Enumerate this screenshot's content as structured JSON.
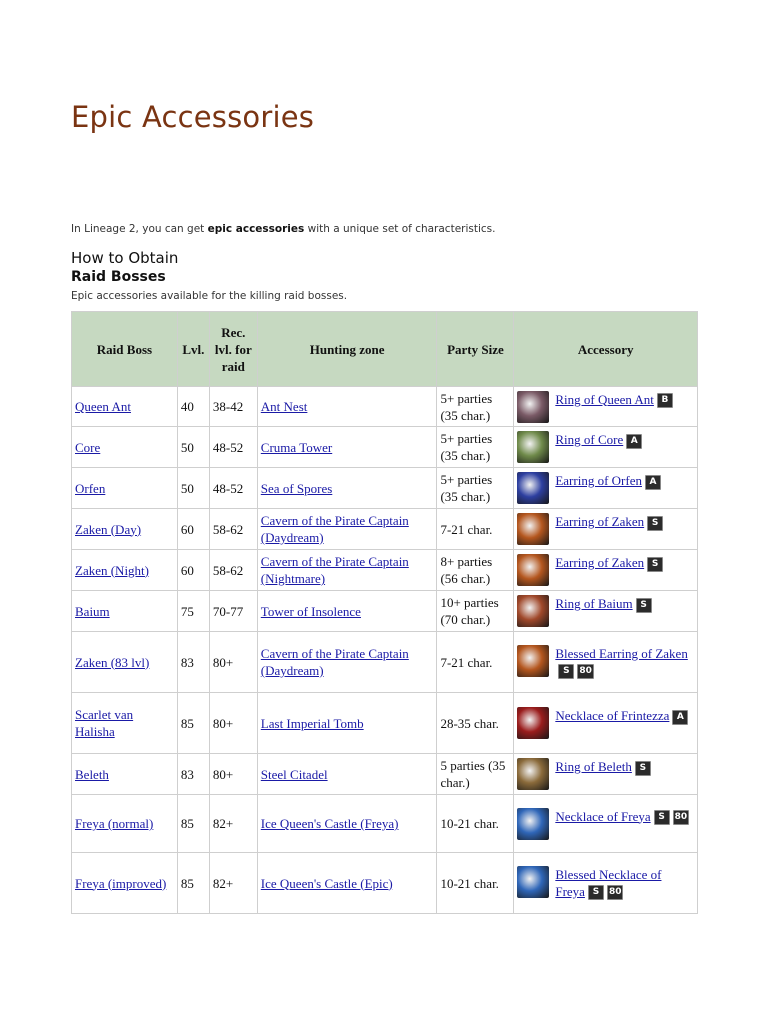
{
  "page": {
    "title": "Epic Accessories",
    "intro_pre": "In Lineage 2, you can get ",
    "intro_bold": "epic accessories",
    "intro_post": " with a unique set of characteristics.",
    "how_to_obtain": "How to Obtain",
    "raid_bosses": "Raid Bosses",
    "raid_bosses_desc": "Epic accessories available for the killing raid bosses."
  },
  "table": {
    "headers": {
      "boss": "Raid Boss",
      "lvl": "Lvl.",
      "rec": "Rec. lvl. for raid",
      "zone": "Hunting zone",
      "party": "Party Size",
      "accessory": "Accessory"
    },
    "rows": [
      {
        "boss": "Queen Ant",
        "lvl": "40",
        "rec": "38-42",
        "zone": "Ant Nest",
        "party": "5+ parties (35 char.)",
        "accessory": "Ring of Queen Ant",
        "grades": [
          "B"
        ],
        "icon": "ring-icon",
        "color": "#7a5a66"
      },
      {
        "boss": "Core",
        "lvl": "50",
        "rec": "48-52",
        "zone": "Cruma Tower",
        "party": "5+ parties (35 char.)",
        "accessory": "Ring of Core",
        "grades": [
          "A"
        ],
        "icon": "ring-icon",
        "color": "#6f8a4a"
      },
      {
        "boss": "Orfen",
        "lvl": "50",
        "rec": "48-52",
        "zone": "Sea of Spores",
        "party": "5+ parties (35 char.)",
        "accessory": "Earring of Orfen",
        "grades": [
          "A"
        ],
        "icon": "earring-icon",
        "color": "#2d3fa0"
      },
      {
        "boss": "Zaken (Day)",
        "lvl": "60",
        "rec": "58-62",
        "zone": "Cavern of the Pirate Captain (Daydream)",
        "party": "7-21 char.",
        "accessory": "Earring of Zaken",
        "grades": [
          "S"
        ],
        "icon": "earring-icon",
        "color": "#b4561e"
      },
      {
        "boss": "Zaken (Night)",
        "lvl": "60",
        "rec": "58-62",
        "zone": "Cavern of the Pirate Captain (Nightmare)",
        "party": "8+ parties (56 char.)",
        "accessory": "Earring of Zaken",
        "grades": [
          "S"
        ],
        "icon": "earring-icon",
        "color": "#b4561e"
      },
      {
        "boss": "Baium",
        "lvl": "75",
        "rec": "70-77",
        "zone": "Tower of Insolence",
        "party": "10+ parties (70 char.)",
        "accessory": "Ring of Baium",
        "grades": [
          "S"
        ],
        "icon": "ring-icon",
        "color": "#a0482a"
      },
      {
        "boss": "Zaken (83 lvl)",
        "lvl": "83",
        "rec": "80+",
        "zone": "Cavern of the Pirate Captain (Daydream)",
        "party": "7-21 char.",
        "accessory": "Blessed Earring of Zaken",
        "grades": [
          "S",
          "80"
        ],
        "icon": "earring-icon",
        "color": "#b4561e"
      },
      {
        "boss": "Scarlet van Halisha",
        "lvl": "85",
        "rec": "80+",
        "zone": "Last Imperial Tomb",
        "party": "28-35 char.",
        "accessory": "Necklace of Frintezza",
        "grades": [
          "A"
        ],
        "icon": "necklace-icon",
        "color": "#9a1c1c"
      },
      {
        "boss": "Beleth",
        "lvl": "83",
        "rec": "80+",
        "zone": "Steel Citadel",
        "party": "5 parties (35 char.)",
        "accessory": "Ring of Beleth",
        "grades": [
          "S"
        ],
        "icon": "ring-icon",
        "color": "#8a6a3a"
      },
      {
        "boss": "Freya (normal)",
        "lvl": "85",
        "rec": "82+",
        "zone": "Ice Queen's Castle (Freya)",
        "party": "10-21 char.",
        "accessory": "Necklace of Freya",
        "grades": [
          "S",
          "80"
        ],
        "icon": "necklace-icon",
        "color": "#2f66b8"
      },
      {
        "boss": "Freya (improved)",
        "lvl": "85",
        "rec": "82+",
        "zone": "Ice Queen's Castle (Epic)",
        "party": "10-21 char.",
        "accessory": "Blessed Necklace of Freya",
        "grades": [
          "S",
          "80"
        ],
        "icon": "necklace-icon",
        "color": "#2f66b8"
      }
    ]
  }
}
